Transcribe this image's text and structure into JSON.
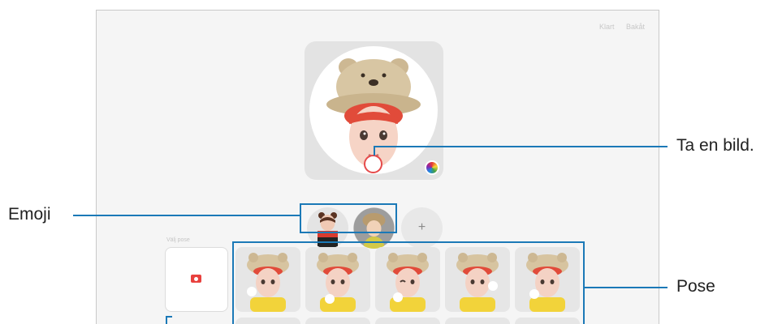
{
  "topbar": {
    "done_label": "Klart",
    "back_label": "Bakåt"
  },
  "preview": {
    "shutter_icon": "shutter-icon",
    "color_icon": "color-wheel-icon"
  },
  "emoji_list": {
    "items": [
      "emoji-avatar-1",
      "emoji-avatar-2"
    ],
    "add_label": "+"
  },
  "pose_section": {
    "title": "Välj pose",
    "camera_icon": "camera-icon",
    "pose_count": 5
  },
  "callouts": {
    "take_photo": "Ta en bild.",
    "emoji": "Emoji",
    "pose": "Pose"
  },
  "colors": {
    "accent": "#1b79b7",
    "shutter": "#e64a4a",
    "camera": "#e8413e"
  }
}
